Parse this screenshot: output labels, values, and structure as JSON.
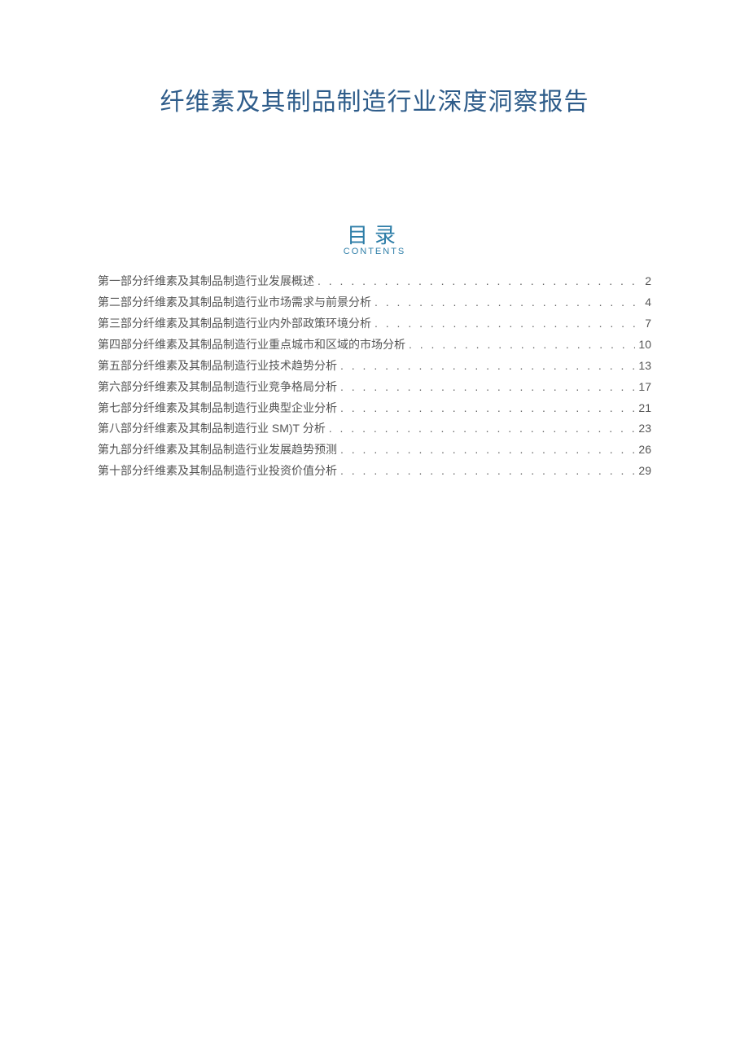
{
  "title": "纤维素及其制品制造行业深度洞察报告",
  "toc": {
    "heading": "目录",
    "subtitle": "CONTENTS",
    "items": [
      {
        "label": "第一部分纤维素及其制品制造行业发展概述",
        "page": "2"
      },
      {
        "label": "第二部分纤维素及其制品制造行业市场需求与前景分析",
        "page": "4"
      },
      {
        "label": "第三部分纤维素及其制品制造行业内外部政策环境分析",
        "page": "7"
      },
      {
        "label": "第四部分纤维素及其制品制造行业重点城市和区域的市场分析",
        "page": "10"
      },
      {
        "label": "第五部分纤维素及其制品制造行业技术趋势分析",
        "page": "13"
      },
      {
        "label": "第六部分纤维素及其制品制造行业竞争格局分析",
        "page": "17"
      },
      {
        "label": "第七部分纤维素及其制品制造行业典型企业分析",
        "page": "21"
      },
      {
        "label": "第八部分纤维素及其制品制造行业 SM)T 分析",
        "page": "23"
      },
      {
        "label": "第九部分纤维素及其制品制造行业发展趋势预测",
        "page": "26"
      },
      {
        "label": "第十部分纤维素及其制品制造行业投资价值分析",
        "page": "29"
      }
    ]
  }
}
